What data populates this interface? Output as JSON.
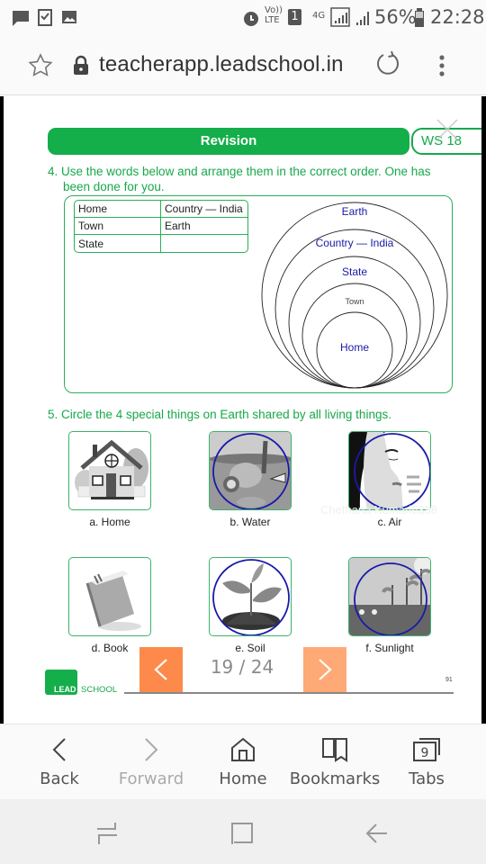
{
  "status_bar": {
    "notification_icons": [
      "message-icon",
      "checkbox-icon",
      "image-icon"
    ],
    "alarm_icon": "alarm-icon",
    "volte": "Vo)) LTE",
    "sim": "1",
    "network": "4G",
    "battery_percent": "56%",
    "time": "22:28"
  },
  "browser": {
    "url": "teacherapp.leadschool.in",
    "bookmark_icon": "star-icon",
    "lock_icon": "lock-icon",
    "reload_icon": "reload-icon",
    "menu_icon": "more-vert-icon"
  },
  "worksheet": {
    "header": "Revision",
    "ws_tag": "WS 18",
    "q4": {
      "text": "4. Use the words below and arrange them in the correct order. One has",
      "text2": "been done for you.",
      "table": [
        [
          "Home",
          "Country — India"
        ],
        [
          "Town",
          "Earth"
        ],
        [
          "State",
          ""
        ]
      ],
      "circles": [
        "Earth",
        "Country — India",
        "State",
        "Town",
        "Home"
      ]
    },
    "q5": {
      "text": "5. Circle the 4 special things on Earth shared by all living things.",
      "items": [
        {
          "label": "a. Home",
          "circled": false
        },
        {
          "label": "b. Water",
          "circled": true
        },
        {
          "label": "c. Air",
          "circled": true
        },
        {
          "label": "d. Book",
          "circled": false
        },
        {
          "label": "e. Soil",
          "circled": true
        },
        {
          "label": "f. Sunlight",
          "circled": true
        }
      ]
    },
    "watermark": "Chethana Kumari6388",
    "footer": {
      "logo_lead": "LEAD",
      "logo_school": "SCHOOL",
      "page_number": "91"
    }
  },
  "pager": {
    "current": "19 / 24",
    "prev_label": "<",
    "next_label": ">"
  },
  "toolbar": {
    "items": [
      {
        "label": "Back",
        "icon": "back-icon",
        "enabled": true
      },
      {
        "label": "Forward",
        "icon": "forward-icon",
        "enabled": false
      },
      {
        "label": "Home",
        "icon": "home-icon",
        "enabled": true
      },
      {
        "label": "Bookmarks",
        "icon": "bookmarks-icon",
        "enabled": true
      },
      {
        "label": "Tabs",
        "icon": "tabs-icon",
        "enabled": true,
        "count": "9"
      }
    ]
  },
  "colors": {
    "green": "#14ae4b",
    "orange_prev": "#fd8a4b",
    "orange_next": "#fea976",
    "circle_blue": "#1a1aa8"
  }
}
